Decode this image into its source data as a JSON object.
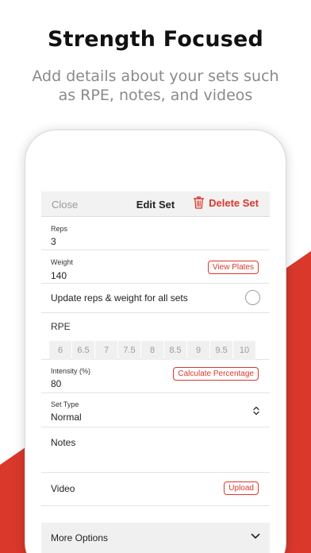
{
  "headline": "Strength Focused",
  "subheadline": "Add details about your sets such as RPE, notes, and videos",
  "colors": {
    "accent": "#d9382b",
    "muted": "#9a9a9a",
    "chip_bg": "#f0f0f0"
  },
  "topbar": {
    "close_label": "Close",
    "title": "Edit Set",
    "delete_label": "Delete Set",
    "delete_icon": "trash-icon"
  },
  "reps": {
    "label": "Reps",
    "value": "3"
  },
  "weight": {
    "label": "Weight",
    "value": "140",
    "action": "View Plates"
  },
  "update_all": {
    "label": "Update reps & weight for all sets",
    "checked": false
  },
  "rpe": {
    "label": "RPE",
    "options": [
      "6",
      "6.5",
      "7",
      "7.5",
      "8",
      "8.5",
      "9",
      "9.5",
      "10"
    ]
  },
  "intensity": {
    "label": "Intensity (%)",
    "value": "80",
    "action": "Calculate Percentage"
  },
  "set_type": {
    "label": "Set Type",
    "value": "Normal",
    "icon": "chevron-up-down-icon"
  },
  "notes": {
    "label": "Notes"
  },
  "video": {
    "label": "Video",
    "action": "Upload"
  },
  "more_options": {
    "label": "More Options",
    "icon": "chevron-down-icon"
  }
}
